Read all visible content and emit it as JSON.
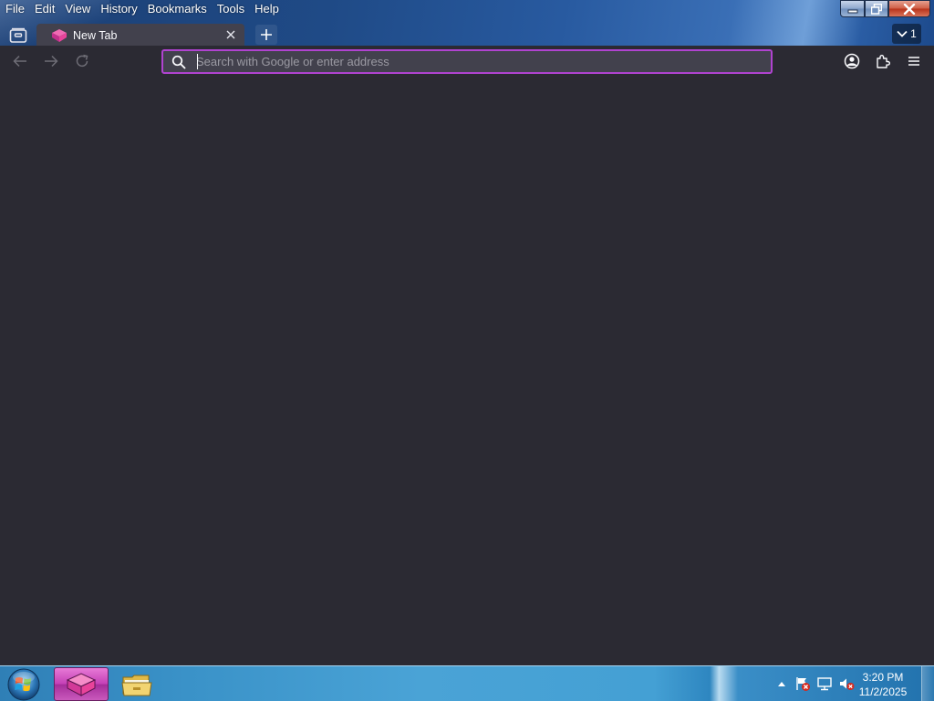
{
  "menu": {
    "items": [
      "File",
      "Edit",
      "View",
      "History",
      "Bookmarks",
      "Tools",
      "Help"
    ]
  },
  "window_controls": {
    "minimize_icon": "minimize-icon",
    "restore_icon": "restore-icon",
    "close_icon": "close-icon"
  },
  "tabs": {
    "list_icon": "tab-list-icon",
    "items": [
      {
        "title": "New Tab",
        "favicon": "browser-logo-icon",
        "selected": true
      }
    ],
    "new_tab_icon": "plus-icon",
    "counter_value": "1",
    "counter_icon": "chevron-down-icon"
  },
  "toolbar": {
    "back_icon": "back-arrow-icon",
    "forward_icon": "forward-arrow-icon",
    "reload_icon": "reload-icon",
    "account_icon": "account-icon",
    "extensions_icon": "extensions-icon",
    "menu_icon": "hamburger-menu-icon"
  },
  "urlbar": {
    "value": "",
    "placeholder": "Search with Google or enter address",
    "search_icon": "search-icon",
    "focus_color": "#b043d0"
  },
  "taskbar": {
    "start_icon": "windows-start-icon",
    "apps": [
      {
        "name": "browser",
        "icon": "browser-logo-icon",
        "active": true
      },
      {
        "name": "file-explorer",
        "icon": "folder-icon",
        "active": false
      }
    ],
    "tray": {
      "icons": [
        "show-hidden-icons-arrow",
        "action-center-flag-icon",
        "network-icon",
        "volume-muted-icon"
      ],
      "time": "3:20 PM",
      "date": "11/2/2025"
    }
  },
  "colors": {
    "content_bg": "#2b2a33",
    "tab_bg": "#42414d",
    "accent": "#b043d0",
    "brand_pink": "#e8439a"
  }
}
